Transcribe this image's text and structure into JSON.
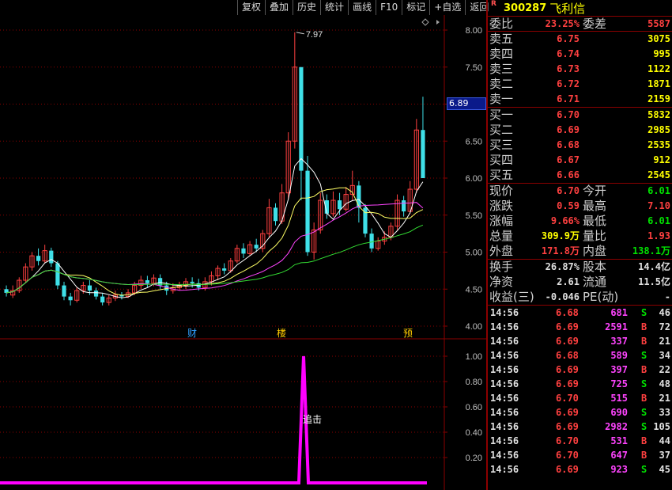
{
  "toolbar": [
    "复权",
    "叠加",
    "历史",
    "统计",
    "画线",
    "F10",
    "标记",
    "+自选",
    "返回"
  ],
  "price_chart": {
    "y_ticks": [
      "8.00",
      "7.50",
      "7.00",
      "6.50",
      "6.00",
      "5.50",
      "5.00",
      "4.50",
      "4.00"
    ],
    "high_label": "7.97",
    "current_price_tag": "6.89",
    "markers": [
      "财",
      "楼",
      "预"
    ],
    "candles": [
      [
        4.5,
        4.45,
        4.55,
        4.4
      ],
      [
        4.42,
        4.48,
        4.55,
        4.38
      ],
      [
        4.48,
        4.62,
        4.66,
        4.45
      ],
      [
        4.62,
        4.8,
        4.85,
        4.58
      ],
      [
        4.8,
        4.95,
        5.0,
        4.75
      ],
      [
        4.95,
        4.88,
        5.05,
        4.82
      ],
      [
        4.88,
        5.02,
        5.1,
        4.85
      ],
      [
        5.02,
        4.85,
        5.06,
        4.8
      ],
      [
        4.85,
        4.55,
        4.88,
        4.5
      ],
      [
        4.55,
        4.4,
        4.6,
        4.35
      ],
      [
        4.4,
        4.35,
        4.45,
        4.28
      ],
      [
        4.35,
        4.48,
        4.52,
        4.32
      ],
      [
        4.48,
        4.55,
        4.6,
        4.44
      ],
      [
        4.55,
        4.48,
        4.62,
        4.42
      ],
      [
        4.48,
        4.4,
        4.52,
        4.36
      ],
      [
        4.4,
        4.32,
        4.45,
        4.28
      ],
      [
        4.32,
        4.38,
        4.42,
        4.28
      ],
      [
        4.38,
        4.42,
        4.48,
        4.34
      ],
      [
        4.42,
        4.4,
        4.46,
        4.36
      ],
      [
        4.4,
        4.45,
        4.5,
        4.38
      ],
      [
        4.45,
        4.55,
        4.6,
        4.42
      ],
      [
        4.55,
        4.62,
        4.68,
        4.5
      ],
      [
        4.62,
        4.58,
        4.68,
        4.52
      ],
      [
        4.58,
        4.65,
        4.7,
        4.54
      ],
      [
        4.65,
        4.55,
        4.7,
        4.5
      ],
      [
        4.55,
        4.48,
        4.6,
        4.42
      ],
      [
        4.48,
        4.52,
        4.58,
        4.44
      ],
      [
        4.52,
        4.55,
        4.6,
        4.48
      ],
      [
        4.55,
        4.6,
        4.65,
        4.5
      ],
      [
        4.6,
        4.58,
        4.66,
        4.52
      ],
      [
        4.58,
        4.52,
        4.64,
        4.48
      ],
      [
        4.52,
        4.6,
        4.66,
        4.48
      ],
      [
        4.6,
        4.68,
        4.74,
        4.55
      ],
      [
        4.68,
        4.78,
        4.82,
        4.62
      ],
      [
        4.78,
        4.75,
        4.85,
        4.7
      ],
      [
        4.75,
        4.88,
        4.92,
        4.72
      ],
      [
        4.88,
        5.05,
        5.1,
        4.85
      ],
      [
        5.05,
        4.98,
        5.12,
        4.92
      ],
      [
        4.98,
        5.1,
        5.15,
        4.95
      ],
      [
        5.1,
        5.05,
        5.18,
        5.0
      ],
      [
        5.05,
        5.25,
        5.3,
        5.0
      ],
      [
        5.25,
        5.6,
        5.72,
        5.2
      ],
      [
        5.6,
        5.42,
        5.66,
        5.36
      ],
      [
        5.42,
        5.8,
        5.92,
        5.38
      ],
      [
        5.8,
        6.5,
        6.62,
        5.72
      ],
      [
        6.5,
        7.5,
        7.97,
        6.4
      ],
      [
        7.5,
        6.1,
        7.4,
        5.7
      ],
      [
        6.1,
        5.0,
        6.3,
        4.95
      ],
      [
        5.0,
        5.3,
        5.4,
        4.9
      ],
      [
        5.3,
        5.7,
        5.8,
        5.25
      ],
      [
        5.7,
        5.52,
        5.78,
        5.45
      ],
      [
        5.52,
        5.7,
        5.82,
        5.48
      ],
      [
        5.7,
        5.58,
        5.8,
        5.5
      ],
      [
        5.58,
        5.78,
        5.88,
        5.55
      ],
      [
        5.78,
        5.9,
        6.1,
        5.7
      ],
      [
        5.9,
        5.6,
        5.96,
        5.4
      ],
      [
        5.6,
        5.25,
        5.65,
        5.2
      ],
      [
        5.25,
        5.05,
        5.32,
        5.0
      ],
      [
        5.05,
        5.15,
        5.2,
        5.02
      ],
      [
        5.15,
        5.2,
        5.28,
        5.1
      ],
      [
        5.2,
        5.35,
        5.4,
        5.16
      ],
      [
        5.35,
        5.7,
        5.78,
        5.3
      ],
      [
        5.7,
        5.55,
        5.76,
        5.48
      ],
      [
        5.55,
        5.85,
        5.96,
        5.52
      ],
      [
        5.85,
        6.65,
        6.8,
        5.8
      ],
      [
        6.65,
        6.0,
        7.1,
        6.0
      ]
    ]
  },
  "indicator_chart": {
    "y_ticks": [
      "1.00",
      "0.80",
      "0.60",
      "0.40",
      "0.20"
    ],
    "label": "追击"
  },
  "stock": {
    "code": "300287",
    "name": "飞利信",
    "flag": "R"
  },
  "weibi": {
    "label": "委比",
    "value": "23.25%",
    "label2": "委差",
    "value2": "5587"
  },
  "asks": [
    {
      "label": "卖五",
      "price": "6.75",
      "qty": "3075"
    },
    {
      "label": "卖四",
      "price": "6.74",
      "qty": "995"
    },
    {
      "label": "卖三",
      "price": "6.73",
      "qty": "1122"
    },
    {
      "label": "卖二",
      "price": "6.72",
      "qty": "1871"
    },
    {
      "label": "卖一",
      "price": "6.71",
      "qty": "2159"
    }
  ],
  "bids": [
    {
      "label": "买一",
      "price": "6.70",
      "qty": "5832"
    },
    {
      "label": "买二",
      "price": "6.69",
      "qty": "2985"
    },
    {
      "label": "买三",
      "price": "6.68",
      "qty": "2535"
    },
    {
      "label": "买四",
      "price": "6.67",
      "qty": "912"
    },
    {
      "label": "买五",
      "price": "6.66",
      "qty": "2545"
    }
  ],
  "quote": [
    {
      "l1": "现价",
      "v1": "6.70",
      "c1": "red",
      "l2": "今开",
      "v2": "6.01",
      "c2": "green"
    },
    {
      "l1": "涨跌",
      "v1": "0.59",
      "c1": "red",
      "l2": "最高",
      "v2": "7.10",
      "c2": "red"
    },
    {
      "l1": "涨幅",
      "v1": "9.66%",
      "c1": "red",
      "l2": "最低",
      "v2": "6.01",
      "c2": "green"
    },
    {
      "l1": "总量",
      "v1": "309.9万",
      "c1": "yellow",
      "l2": "量比",
      "v2": "1.93",
      "c2": "red"
    },
    {
      "l1": "外盘",
      "v1": "171.8万",
      "c1": "red",
      "l2": "内盘",
      "v2": "138.1万",
      "c2": "green"
    }
  ],
  "fundamentals": [
    {
      "l1": "换手",
      "v1": "26.87%",
      "l2": "股本",
      "v2": "14.4亿"
    },
    {
      "l1": "净资",
      "v1": "2.61",
      "l2": "流通",
      "v2": "11.5亿"
    },
    {
      "l1": "收益(三)",
      "v1": "-0.046",
      "l2": "PE(动)",
      "v2": "-"
    }
  ],
  "ticks": [
    {
      "time": "14:56",
      "price": "6.68",
      "pc": "red",
      "vol": "681",
      "side": "S",
      "cnt": "46"
    },
    {
      "time": "14:56",
      "price": "6.69",
      "pc": "red",
      "vol": "2591",
      "side": "B",
      "cnt": "72"
    },
    {
      "time": "14:56",
      "price": "6.69",
      "pc": "red",
      "vol": "337",
      "side": "B",
      "cnt": "21"
    },
    {
      "time": "14:56",
      "price": "6.68",
      "pc": "red",
      "vol": "589",
      "side": "S",
      "cnt": "34"
    },
    {
      "time": "14:56",
      "price": "6.69",
      "pc": "red",
      "vol": "397",
      "side": "B",
      "cnt": "22"
    },
    {
      "time": "14:56",
      "price": "6.69",
      "pc": "red",
      "vol": "725",
      "side": "S",
      "cnt": "48"
    },
    {
      "time": "14:56",
      "price": "6.70",
      "pc": "red",
      "vol": "515",
      "side": "B",
      "cnt": "21"
    },
    {
      "time": "14:56",
      "price": "6.69",
      "pc": "red",
      "vol": "690",
      "side": "S",
      "cnt": "33"
    },
    {
      "time": "14:56",
      "price": "6.69",
      "pc": "red",
      "vol": "2982",
      "side": "S",
      "cnt": "105"
    },
    {
      "time": "14:56",
      "price": "6.70",
      "pc": "red",
      "vol": "531",
      "side": "B",
      "cnt": "44"
    },
    {
      "time": "14:56",
      "price": "6.70",
      "pc": "red",
      "vol": "647",
      "side": "B",
      "cnt": "37"
    },
    {
      "time": "14:56",
      "price": "6.69",
      "pc": "red",
      "vol": "923",
      "side": "S",
      "cnt": "45"
    }
  ],
  "colors": {
    "up": "#ff4040",
    "down": "#3fe0e8",
    "grid": "#8b0000",
    "ma5": "#ffffff",
    "ma10": "#ffff66",
    "ma20": "#ff44ff",
    "ma60": "#33dd33",
    "signal": "#ff00ff"
  }
}
